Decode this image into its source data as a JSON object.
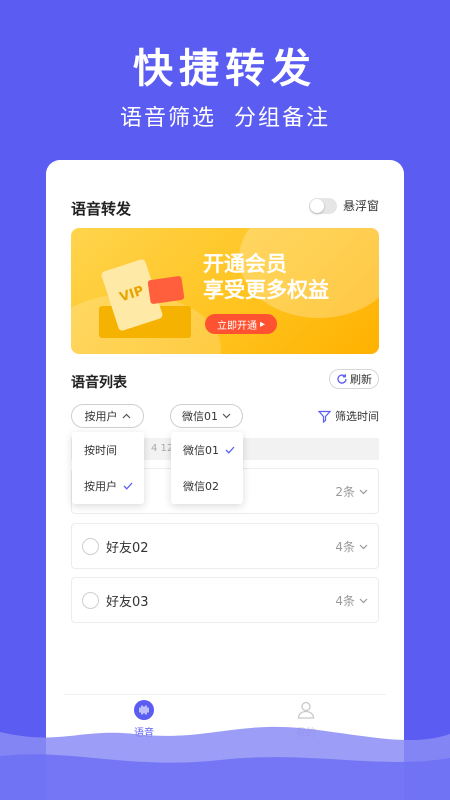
{
  "hero": {
    "title": "快捷转发",
    "subtitle": "语音筛选  分组备注"
  },
  "card": {
    "title": "语音转发",
    "float_window_label": "悬浮窗",
    "float_window_on": false
  },
  "banner": {
    "line1": "开通会员",
    "line2": "享受更多权益",
    "button": "立即开通",
    "badge": "VIP"
  },
  "list": {
    "title": "语音列表",
    "refresh": "刷新",
    "filter_user": "按用户",
    "filter_wechat": "微信01",
    "filter_time": "筛选时间",
    "date_hint": "4  12 ~",
    "items": [
      {
        "name": "",
        "count": "2条"
      },
      {
        "name": "好友02",
        "count": "4条"
      },
      {
        "name": "好友03",
        "count": "4条"
      }
    ]
  },
  "dropdown_user": {
    "options": [
      "按时间",
      "按用户"
    ],
    "selected": "按用户"
  },
  "dropdown_wechat": {
    "options": [
      "微信01",
      "微信02"
    ],
    "selected": "微信01"
  },
  "tabbar": {
    "voice": "语音",
    "me": "我的"
  },
  "colors": {
    "brand": "#5B5CF2",
    "banner": "#FFC21C",
    "cta": "#FF5230"
  }
}
